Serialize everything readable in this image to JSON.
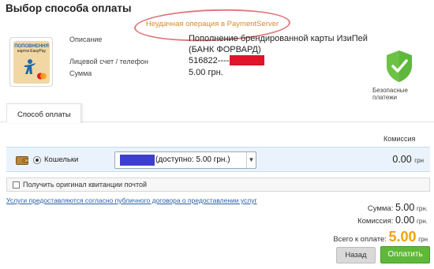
{
  "page": {
    "title": "Выбор способа оплаты"
  },
  "error": {
    "message": "Неудачная операция в PaymentServer"
  },
  "card": {
    "brand_line1": "ПОПОВНЕННЯ",
    "brand_line2": "карток EasyPay"
  },
  "details": {
    "description_label": "Описание",
    "description_value_line1": "Пополнение брендированной карты ИзиПей",
    "description_value_line2": "(БАНК ФОРВАРД)",
    "account_label": "Лицевой счет / телефон",
    "account_value": "516822-----",
    "amount_label": "Сумма",
    "amount_value": "5.00 грн."
  },
  "security": {
    "label": "Безопасные платежи",
    "icon": "shield-check-icon",
    "color": "#5fb83a"
  },
  "tabs": [
    {
      "label": "Способ оплаты",
      "active": true
    }
  ],
  "payment": {
    "commission_header": "Комиссия",
    "method_label": "Кошельки",
    "select_value": "(доступно: 5.00 грн.)",
    "select_arrow": "▼",
    "commission_value": "0.00",
    "commission_currency": "грн"
  },
  "receipt": {
    "label": "Получить оригинал квитанции почтой",
    "checked": false
  },
  "terms": {
    "link_text": "Услуги предоставляются согласно публичного договора о предоставлении услуг"
  },
  "summary": {
    "sum_label": "Сумма:",
    "sum_value": "5.00",
    "sum_currency": "грн.",
    "commission_label": "Комиссия:",
    "commission_value": "0.00",
    "commission_currency": "грн.",
    "total_label": "Всего к оплате:",
    "total_value": "5.00",
    "total_currency": "грн",
    "total_color": "#f0a30a"
  },
  "buttons": {
    "back_label": "Назад",
    "pay_label": "Оплатить",
    "pay_color": "#5fb83a"
  }
}
